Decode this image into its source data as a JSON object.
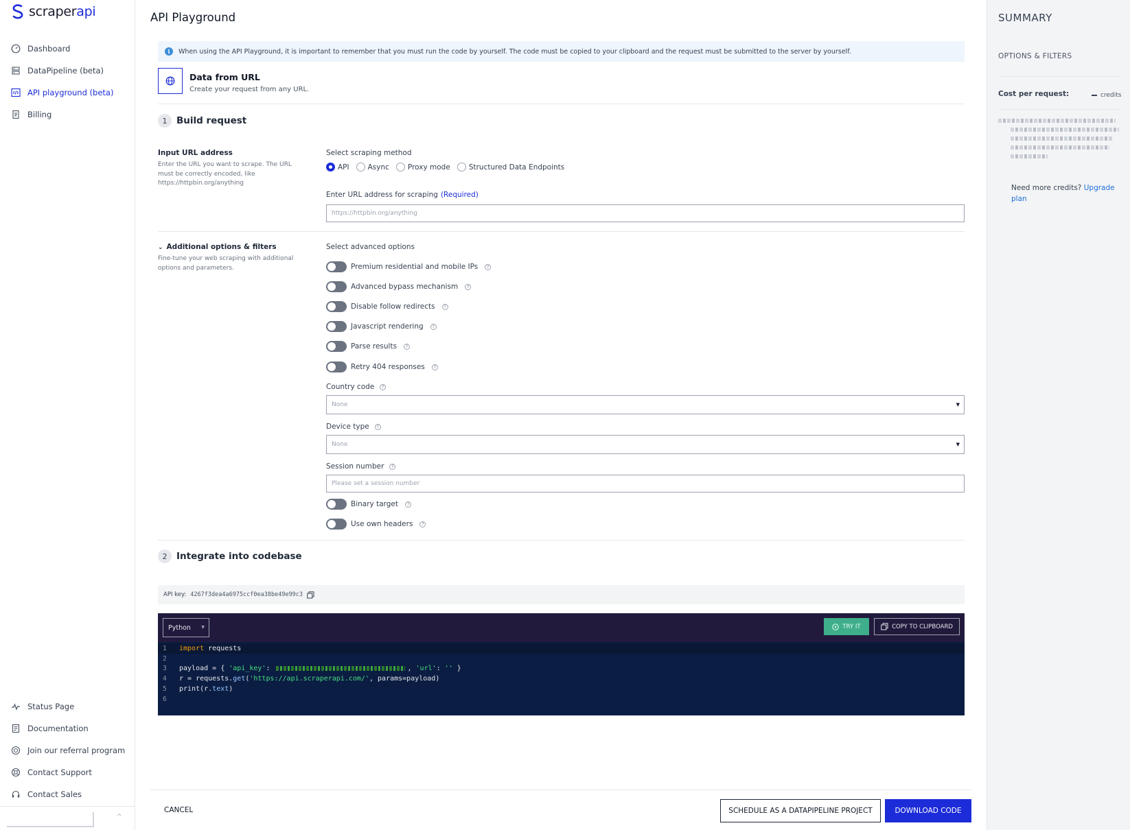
{
  "brand": {
    "name_part1": "scraper",
    "name_part2": "api"
  },
  "sidebar": {
    "nav": [
      {
        "label": "Dashboard",
        "icon": "dashboard-icon"
      },
      {
        "label": "DataPipeline (beta)",
        "icon": "pipeline-icon"
      },
      {
        "label": "API playground (beta)",
        "icon": "code-icon",
        "active": true
      },
      {
        "label": "Billing",
        "icon": "billing-icon"
      }
    ],
    "bottom": [
      {
        "label": "Status Page",
        "icon": "pulse-icon"
      },
      {
        "label": "Documentation",
        "icon": "document-icon"
      },
      {
        "label": "Join our referral program",
        "icon": "referral-icon"
      },
      {
        "label": "Contact Support",
        "icon": "lifebuoy-icon"
      },
      {
        "label": "Contact Sales",
        "icon": "headset-icon"
      }
    ]
  },
  "page": {
    "title": "API Playground",
    "info": "When using the API Playground, it is important to remember that you must run the code by yourself. The code must be copied to your clipboard and the request must be submitted to the server by yourself.",
    "source": {
      "title": "Data from URL",
      "subtitle": "Create your request from any URL."
    }
  },
  "build": {
    "step": "1",
    "title": "Build request",
    "input_title": "Input URL address",
    "input_desc": "Enter the URL you want to scrape. The URL must be correctly encoded, like https://httpbin.org/anything",
    "method_label": "Select scraping method",
    "methods": [
      "API",
      "Async",
      "Proxy mode",
      "Structured Data Endpoints"
    ],
    "selected_method": "API",
    "url_label": "Enter URL address for scraping",
    "url_required": "(Required)",
    "url_placeholder": "https://httpbin.org/anything"
  },
  "options": {
    "title": "Additional options & filters",
    "desc": "Fine-tune your web scraping with additional options and parameters.",
    "advanced_label": "Select advanced options",
    "toggles": [
      "Premium residential and mobile IPs",
      "Advanced bypass mechanism",
      "Disable follow redirects",
      "Javascript rendering",
      "Parse results",
      "Retry 404 responses"
    ],
    "country_label": "Country code",
    "country_value": "None",
    "device_label": "Device type",
    "device_value": "None",
    "session_label": "Session number",
    "session_placeholder": "Please set a session number",
    "toggles2": [
      "Binary target",
      "Use own headers"
    ]
  },
  "integrate": {
    "step": "2",
    "title": "Integrate into codebase",
    "api_key_label": "API key:",
    "api_key": "4267f3dea4a6975ccf0ea38be49e99c3",
    "language": "Python",
    "try_label": "TRY IT",
    "copy_label": "COPY TO CLIPBOARD",
    "code": {
      "l1_kw": "import",
      "l1_rest": " requests",
      "l3_a": "payload = { ",
      "l3_key1": "'api_key'",
      "l3_colon": ": ",
      "l3_comma": ", ",
      "l3_key2": "'url'",
      "l3_colon2": ": ",
      "l3_val2": "''",
      "l3_end": " }",
      "l4_a": "r = requests.",
      "l4_fn": "get",
      "l4_b": "(",
      "l4_url": "'https://api.scraperapi.com/'",
      "l4_c": ", params=payload)",
      "l5_a": "print(r.",
      "l5_fn": "text",
      "l5_b": ")",
      "line_numbers": [
        "1",
        "2",
        "3",
        "4",
        "5",
        "6"
      ]
    }
  },
  "footer": {
    "cancel": "CANCEL",
    "schedule": "SCHEDULE AS A DATAPIPELINE PROJECT",
    "download": "DOWNLOAD CODE"
  },
  "summary": {
    "title": "SUMMARY",
    "subtitle": "OPTIONS & FILTERS",
    "cost_label": "Cost per request:",
    "cost_unit": "credits",
    "need_more": "Need more credits?",
    "upgrade": "Upgrade plan"
  },
  "colors": {
    "accent": "#1c2cd8",
    "try_green": "#3fae8a",
    "code_bg": "#0b1d43"
  }
}
